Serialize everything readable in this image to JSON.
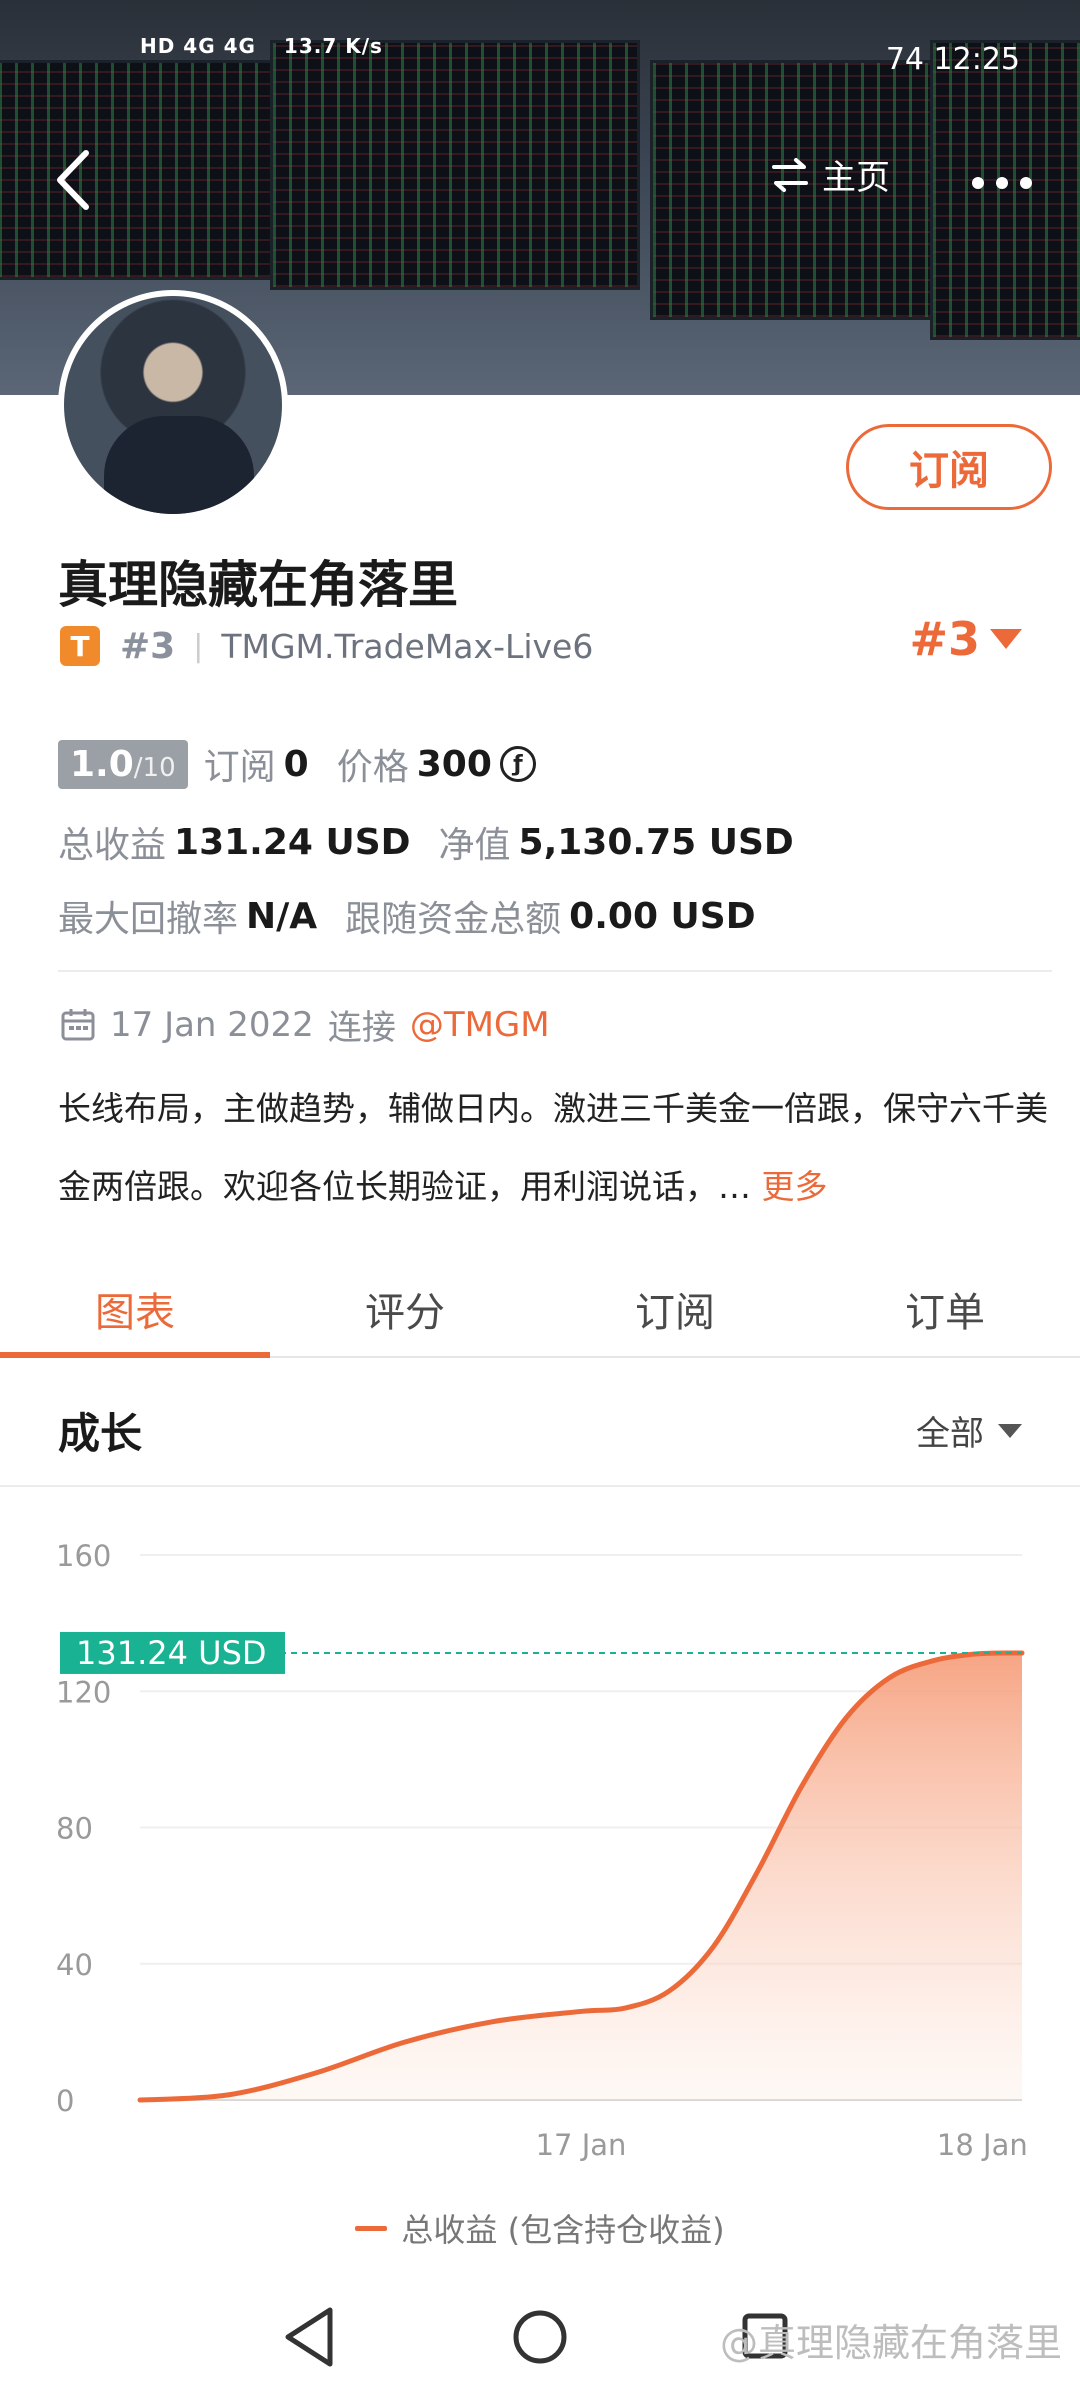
{
  "status_bar": {
    "network": "HD 4G  4G",
    "speed": "13.7 K/s",
    "right": "74  12:25"
  },
  "header": {
    "home_label": "主页"
  },
  "profile": {
    "name": "真理隐藏在角落里",
    "subscribe_label": "订阅",
    "broker_badge": "T",
    "rank_small": "#3",
    "server": "TMGM.TradeMax-Live6",
    "rank_big": "#3"
  },
  "stats": {
    "score": "1.0",
    "score_max": "/10",
    "subscriptions_label": "订阅",
    "subscriptions_value": "0",
    "price_label": "价格",
    "price_value": "300",
    "price_coin": "ƒ",
    "total_profit_label": "总收益",
    "total_profit_value": "131.24 USD",
    "equity_label": "净值",
    "equity_value": "5,130.75 USD",
    "max_drawdown_label": "最大回撤率",
    "max_drawdown_value": "N/A",
    "follow_funds_label": "跟随资金总额",
    "follow_funds_value": "0.00 USD"
  },
  "since": {
    "date": "17 Jan 2022",
    "connect_label": "连接",
    "broker": "@TMGM"
  },
  "description": {
    "text": "长线布局，主做趋势，辅做日内。激进三千美金一倍跟，保守六千美金两倍跟。欢迎各位长期验证，用利润说话，…",
    "more_label": "更多"
  },
  "tabs": [
    {
      "label": "图表",
      "active": true
    },
    {
      "label": "评分",
      "active": false
    },
    {
      "label": "订阅",
      "active": false
    },
    {
      "label": "订单",
      "active": false
    }
  ],
  "growth": {
    "title": "成长",
    "range_label": "全部"
  },
  "chart_data": {
    "type": "area",
    "y_ticks": [
      "160",
      "120",
      "80",
      "40",
      "0"
    ],
    "x_tick_labels": [
      "17 Jan",
      "18 Jan"
    ],
    "ylim": [
      0,
      160
    ],
    "current_value_label": "131.24 USD",
    "current_value": 131.24,
    "series": [
      {
        "name": "总收益 (包含持仓收益)",
        "x": [
          0,
          0.1,
          0.2,
          0.3,
          0.4,
          0.5,
          0.55,
          0.6,
          0.65,
          0.7,
          0.75,
          0.8,
          0.85,
          0.9,
          0.95,
          1.0
        ],
        "values": [
          0,
          1.5,
          8,
          17,
          23,
          26,
          27,
          32,
          45,
          67,
          92,
          112,
          124,
          129,
          131,
          131.24
        ]
      }
    ],
    "colors": {
      "line": "#ec6a3a",
      "fill": "#f6a07e",
      "marker": "#19b394"
    }
  },
  "legend": {
    "label": "总收益 (包含持仓收益)"
  },
  "watermark": "@真理隐藏在角落里"
}
